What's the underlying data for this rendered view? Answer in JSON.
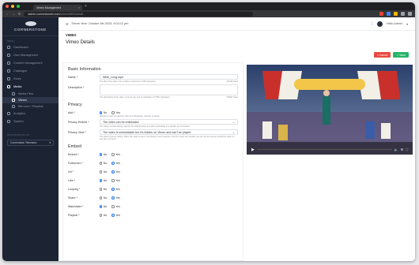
{
  "browser": {
    "tab_title": "Vimeo Management",
    "url_host": "admin.cornerstonetv.com",
    "url_path": "/vimeo/MEDIA/edit"
  },
  "sidebar": {
    "logo_text": "CORNERSTONE",
    "menu_header": "MENU",
    "items": [
      {
        "label": "Dashboard"
      },
      {
        "label": "User Management"
      },
      {
        "label": "Content Management"
      },
      {
        "label": "Catalogue"
      },
      {
        "label": "Roles"
      },
      {
        "label": "Media"
      }
    ],
    "subitems": [
      {
        "label": "Media Files"
      },
      {
        "label": "Vimeo"
      },
      {
        "label": "Bitmovin / Playlists"
      }
    ],
    "items_after": [
      {
        "label": "Analytics"
      },
      {
        "label": "System"
      }
    ],
    "network_header": "NOW WORKING ON",
    "network_value": "Cornerstone Television"
  },
  "topbar": {
    "server_time": "Server time: October 6th 2025, 6:03:12 pm",
    "user": "Hello Admin"
  },
  "page": {
    "breadcrumb": "VIMEO",
    "title": "Vimeo Details",
    "cancel_label": "Cancel",
    "save_label": "Save"
  },
  "form": {
    "basic_title": "Basic Information",
    "name_label": "Name *",
    "name_value": "Wish_Long.mp4",
    "name_help": "The title of the video. Can contain a maximum of 128 characters.",
    "name_count": "13/128 chars",
    "description_label": "Description *",
    "description_help": "The description of the video. It can be any text in markdown or HTML characters.",
    "description_count": "0/5000 chars",
    "privacy_title": "Privacy",
    "add_label": "Add *",
    "add_help": "Whether a user can add the video to a Showcase, channel, or group.",
    "privacy_embed_label": "Privacy Embed *",
    "privacy_embed_value": "The video can be embedded",
    "privacy_embed_help": "The video's embed setting. Specify the whitelist value to restrict embedding to a specific set of domains.",
    "privacy_view_label": "Privacy View *",
    "privacy_view_value": "The video is embeddable but it's hidden on Vimeo and can't be played",
    "privacy_view_help": "The video's privacy setting. When this value is users, the privacy is set to anyone. Only the users who contain you can see the source embed the video on any site or product.",
    "embed_title": "Embed",
    "radio_no": "No",
    "radio_yes": "Yes",
    "embed_fields": [
      {
        "label": "Embed *",
        "selected": "no"
      },
      {
        "label": "Fullscreen *",
        "selected": "yes"
      },
      {
        "label": "Hd *",
        "selected": "yes"
      },
      {
        "label": "Like *",
        "selected": "no"
      },
      {
        "label": "Looping *",
        "selected": "yes"
      },
      {
        "label": "Share *",
        "selected": "yes"
      },
      {
        "label": "Watchlater *",
        "selected": "no"
      },
      {
        "label": "Playbar *",
        "selected": "yes"
      }
    ],
    "add_selected": "no"
  },
  "colors": {
    "sidebar_bg": "#1c2333",
    "cancel": "#e8483f",
    "save": "#25b46a",
    "radio_on": "#2f7ff0"
  }
}
